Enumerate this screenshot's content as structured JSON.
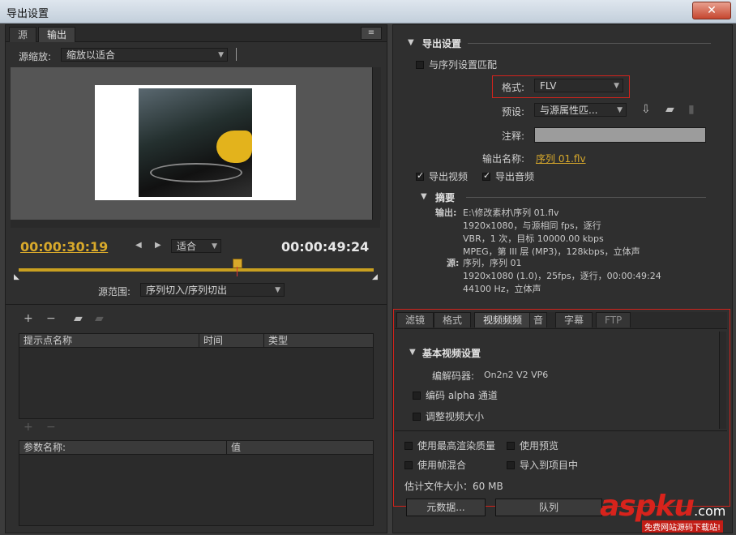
{
  "window": {
    "title": "导出设置",
    "close": "✕"
  },
  "left": {
    "tabs": [
      "源",
      "输出"
    ],
    "menu_icon": "≡",
    "source_scale": {
      "label": "源缩放:",
      "value": "缩放以适合"
    },
    "timecode_current": "00:00:30:19",
    "timecode_total": "00:00:49:24",
    "fit": {
      "value": "适合"
    },
    "source_range": {
      "label": "源范围:",
      "value": "序列切入/序列切出"
    },
    "cue_table": {
      "headers": [
        "提示点名称",
        "时间",
        "类型"
      ]
    },
    "param_table": {
      "headers": [
        "参数名称:",
        "值"
      ]
    }
  },
  "right": {
    "export_settings_title": "导出设置",
    "match_sequence": "与序列设置匹配",
    "format": {
      "label": "格式:",
      "value": "FLV"
    },
    "preset": {
      "label": "预设:",
      "value": "与源属性匹..."
    },
    "comments": {
      "label": "注释:"
    },
    "output_name": {
      "label": "输出名称:",
      "value": "序列 01.flv"
    },
    "export_video": "导出视频",
    "export_audio": "导出音频",
    "summary": {
      "title": "摘要",
      "output_label": "输出:",
      "output_lines": [
        "E:\\修改素材\\序列 01.flv",
        "1920x1080，与源相同 fps，逐行",
        "VBR，1 次，目标 10000.00 kbps",
        "MPEG，第 III 层 (MP3)，128kbps，立体声"
      ],
      "source_label": "源:",
      "source_lines": [
        "序列，序列 01",
        "1920x1080 (1.0)，25fps，逐行，00:00:49:24",
        "44100 Hz，立体声"
      ]
    },
    "lower_tabs": [
      "滤镜",
      "格式",
      "视频频频",
      "音",
      "字幕",
      "FTP"
    ],
    "basic_video": "基本视频设置",
    "codec": {
      "label": "编解码器:",
      "value": "On2n2 V2 VP6"
    },
    "encode_alpha": "编码 alpha 通道",
    "resize_video": "调整视频大小",
    "max_render": "使用最高渲染质量",
    "use_preview": "使用预览",
    "frame_blend": "使用帧混合",
    "import_project": "导入到项目中",
    "file_size": "估计文件大小：60 MB",
    "button_metadata": "元数据...",
    "button_queue": "队列"
  },
  "watermark": {
    "brand": "aspku",
    "tld": ".com",
    "tagline": "免费网站源码下载站!"
  },
  "colors": {
    "accent": "#d8a92b",
    "highlight": "#d3231c"
  }
}
